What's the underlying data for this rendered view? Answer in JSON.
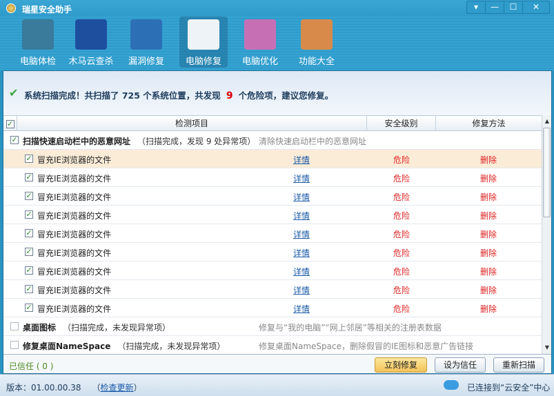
{
  "window": {
    "title": "瑞星安全助手",
    "controls": [
      "▾",
      "—",
      "☐",
      "✕"
    ]
  },
  "toolbar": [
    {
      "label": "电脑体检",
      "icon": "monitor-pulse-icon",
      "color": "#3a7a9a"
    },
    {
      "label": "木马云查杀",
      "icon": "shield-icon",
      "color": "#1e4f9e"
    },
    {
      "label": "漏洞修复",
      "icon": "windows-refresh-icon",
      "color": "#2d6fb5"
    },
    {
      "label": "电脑修复",
      "icon": "checklist-icon",
      "color": "#eef3f7",
      "active": true
    },
    {
      "label": "电脑优化",
      "icon": "magic-wand-monitor-icon",
      "color": "#c76fb5"
    },
    {
      "label": "功能大全",
      "icon": "disc-box-icon",
      "color": "#d88a4a"
    }
  ],
  "status": {
    "pre": "系统扫描完成！共扫描了 725 个系统位置，共发现",
    "count": "9",
    "post": "个危险项，建议您修复。"
  },
  "table": {
    "headers": [
      "检测项目",
      "安全级别",
      "修复方法"
    ],
    "group1": {
      "name": "扫描快速启动栏中的恶意网址",
      "status": "（扫描完成，发现 9 处异常项）",
      "desc": "清除快速启动栏中的恶意网址"
    },
    "items": [
      {
        "name": "冒充IE浏览器的文件",
        "link": "详情",
        "level": "危险",
        "fix": "删除"
      },
      {
        "name": "冒充IE浏览器的文件",
        "link": "详情",
        "level": "危险",
        "fix": "删除"
      },
      {
        "name": "冒充IE浏览器的文件",
        "link": "详情",
        "level": "危险",
        "fix": "删除"
      },
      {
        "name": "冒充IE浏览器的文件",
        "link": "详情",
        "level": "危险",
        "fix": "删除"
      },
      {
        "name": "冒充IE浏览器的文件",
        "link": "详情",
        "level": "危险",
        "fix": "删除"
      },
      {
        "name": "冒充IE浏览器的文件",
        "link": "详情",
        "level": "危险",
        "fix": "删除"
      },
      {
        "name": "冒充IE浏览器的文件",
        "link": "详情",
        "level": "危险",
        "fix": "删除"
      },
      {
        "name": "冒充IE浏览器的文件",
        "link": "详情",
        "level": "危险",
        "fix": "删除"
      },
      {
        "name": "冒充IE浏览器的文件",
        "link": "详情",
        "level": "危险",
        "fix": "删除"
      }
    ],
    "group2": {
      "name": "桌面图标",
      "status": "（扫描完成，未发现异常项）",
      "desc": "修复与“我的电脑”“网上邻居”等相关的注册表数据"
    },
    "group3": {
      "name": "修复桌面NameSpace",
      "status": "（扫描完成，未发现异常项）",
      "desc": "修复桌面NameSpace，删除假冒的IE图标和恶意广告链接"
    }
  },
  "bottom": {
    "trusted": "已信任 ( 0 )",
    "fix_now": "立刻修复",
    "set_trusted": "设为信任",
    "rescan": "重新扫描"
  },
  "footer": {
    "version": "版本：01.00.00.38",
    "update_open": "（",
    "update": "检查更新",
    "update_close": "）",
    "connection": "已连接到“云安全”中心"
  }
}
